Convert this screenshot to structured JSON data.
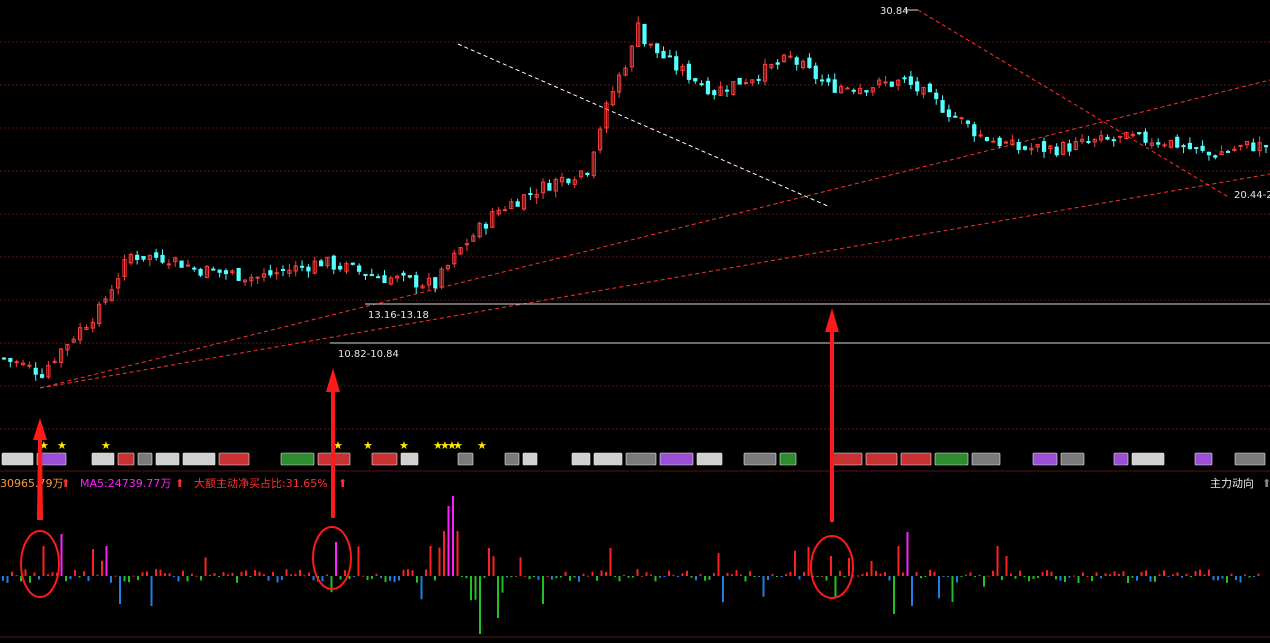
{
  "colors": {
    "background": "#000000",
    "up": "#ff3c3c",
    "down": "#54ffff",
    "grid": "#5a1414",
    "trendline": "#ff3030",
    "whiteTrend": "#ffffff",
    "mainRed": "#ff2020",
    "mainMagenta": "#ff20ff",
    "mainGreen": "#22c022",
    "mainBlue": "#1e7fe0",
    "ma5": "#ff20ff",
    "ratio": "#ff3030",
    "today": "#ff9a3c",
    "star": "#ffe800",
    "arrow": "#ff1a1a"
  },
  "price_labels": {
    "high": "30.84",
    "support_upper": "13.16-13.18",
    "support_lower": "10.82-10.84",
    "right_edge": "20.44-2"
  },
  "indicator": {
    "today_text": "30965.79万",
    "ma5_text": "MA5:24739.77万",
    "ratio_text": "大额主动净买占比:31.65%",
    "panel_name": "主力动向"
  },
  "icons": {
    "star": "star-icon",
    "up_arrow": "up-arrow-icon",
    "event_tag": "event-tag-icon"
  },
  "chart_data": [
    {
      "type": "candlestick",
      "title": "",
      "xlabel": "",
      "ylabel": "",
      "grid": true,
      "x": "trading-day index 0-199 (no axis labels printed)",
      "ylim": [
        5.0,
        32.0
      ],
      "annotated_high": 30.84,
      "support_zones": [
        [
          13.16,
          13.18
        ],
        [
          10.82,
          10.84
        ]
      ],
      "trend_pivots_day_close": [
        [
          0,
          6.6
        ],
        [
          6,
          6.2
        ],
        [
          15,
          8.2
        ],
        [
          20,
          10.5
        ],
        [
          26,
          10.4
        ],
        [
          30,
          9.9
        ],
        [
          40,
          9.5
        ],
        [
          50,
          10.2
        ],
        [
          60,
          9.5
        ],
        [
          68,
          9.2
        ],
        [
          72,
          10.8
        ],
        [
          78,
          12.9
        ],
        [
          86,
          14.5
        ],
        [
          92,
          15.5
        ],
        [
          96,
          22.0
        ],
        [
          100,
          28.0
        ],
        [
          106,
          24.5
        ],
        [
          112,
          22.0
        ],
        [
          118,
          23.5
        ],
        [
          124,
          25.5
        ],
        [
          130,
          22.5
        ],
        [
          136,
          22.5
        ],
        [
          142,
          23.0
        ],
        [
          148,
          20.5
        ],
        [
          154,
          18.0
        ],
        [
          160,
          17.0
        ],
        [
          166,
          17.0
        ],
        [
          172,
          17.5
        ],
        [
          178,
          17.8
        ],
        [
          184,
          17.5
        ],
        [
          190,
          16.5
        ],
        [
          196,
          17.2
        ]
      ]
    },
    {
      "type": "bar",
      "title": "主力动向",
      "series": [
        {
          "name": "MA5",
          "last_value": 24739.77
        }
      ],
      "latest_value": 30965.79,
      "ratio_percent": 31.65,
      "legend": "top-left",
      "bars": "about 280 bars, positive = red/magenta, negative = green/blue"
    }
  ]
}
